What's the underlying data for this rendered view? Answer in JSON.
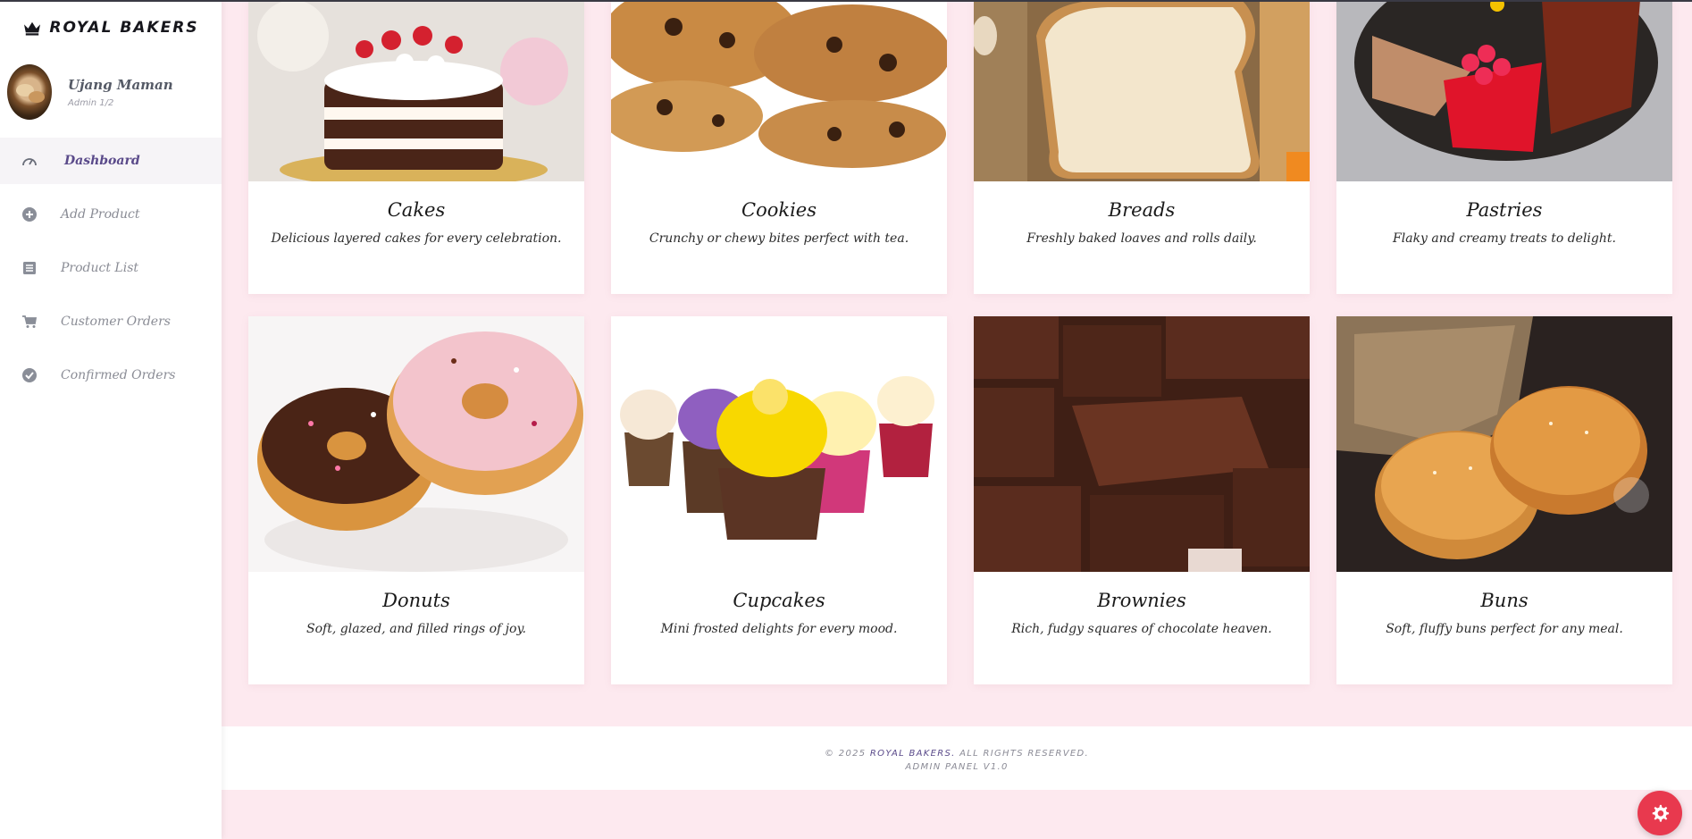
{
  "brand": {
    "name": "ROYAL BAKERS",
    "icon": "crown-icon"
  },
  "profile": {
    "name": "Ujang Maman",
    "role": "Admin 1/2"
  },
  "sidebar": {
    "items": [
      {
        "label": "Dashboard",
        "icon": "gauge-icon",
        "active": true
      },
      {
        "label": "Add Product",
        "icon": "plus-circle-icon"
      },
      {
        "label": "Product List",
        "icon": "list-icon"
      },
      {
        "label": "Customer Orders",
        "icon": "cart-icon"
      },
      {
        "label": "Confirmed Orders",
        "icon": "check-circle-icon"
      }
    ]
  },
  "categories": [
    {
      "title": "Cakes",
      "desc": "Delicious layered cakes for every celebration."
    },
    {
      "title": "Cookies",
      "desc": "Crunchy or chewy bites perfect with tea."
    },
    {
      "title": "Breads",
      "desc": "Freshly baked loaves and rolls daily."
    },
    {
      "title": "Pastries",
      "desc": "Flaky and creamy treats to delight."
    },
    {
      "title": "Donuts",
      "desc": "Soft, glazed, and filled rings of joy."
    },
    {
      "title": "Cupcakes",
      "desc": "Mini frosted delights for every mood."
    },
    {
      "title": "Brownies",
      "desc": "Rich, fudgy squares of chocolate heaven."
    },
    {
      "title": "Buns",
      "desc": "Soft, fluffy buns perfect for any meal."
    }
  ],
  "footer": {
    "prefix": "© 2025 ",
    "brand": "ROYAL BAKERS.",
    "suffix": " ALL RIGHTS RESERVED.",
    "line2": "ADMIN PANEL V1.0"
  },
  "fab": {
    "icon": "gear-icon"
  },
  "colors": {
    "background": "#fde9ef",
    "accent": "#5a4a8a",
    "fab": "#e8394e"
  }
}
